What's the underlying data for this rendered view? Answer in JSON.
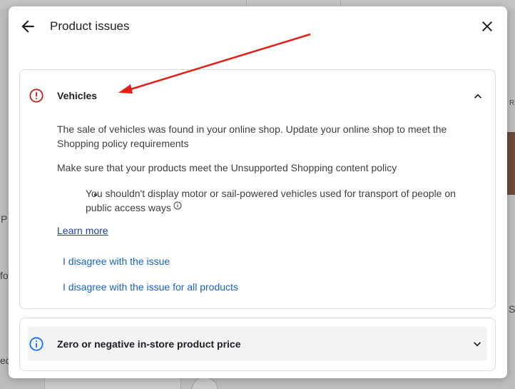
{
  "dialog": {
    "title": "Product issues"
  },
  "issues": [
    {
      "title": "Vehicles",
      "expanded": true,
      "icon": "error-icon",
      "description": "The sale of vehicles was found in your online shop. Update your online shop to meet the Shopping policy requirements",
      "policy_note": "Make sure that your products meet the Unsupported Shopping content policy",
      "bullets": [
        "You shouldn't display motor or sail-powered vehicles used for transport of people on public access ways"
      ],
      "learn_more": "Learn more",
      "actions": [
        "I disagree with the issue",
        "I disagree with the issue for all products"
      ]
    },
    {
      "title": "Zero or negative in-store product price",
      "expanded": false,
      "icon": "info-icon"
    }
  ],
  "background": {
    "fragments": [
      "P",
      "fo",
      "ed",
      "S",
      "R"
    ]
  },
  "colors": {
    "error": "#c5221f",
    "info": "#1a73e8",
    "link": "#1565c0",
    "annotation_arrow": "#e0201b"
  }
}
